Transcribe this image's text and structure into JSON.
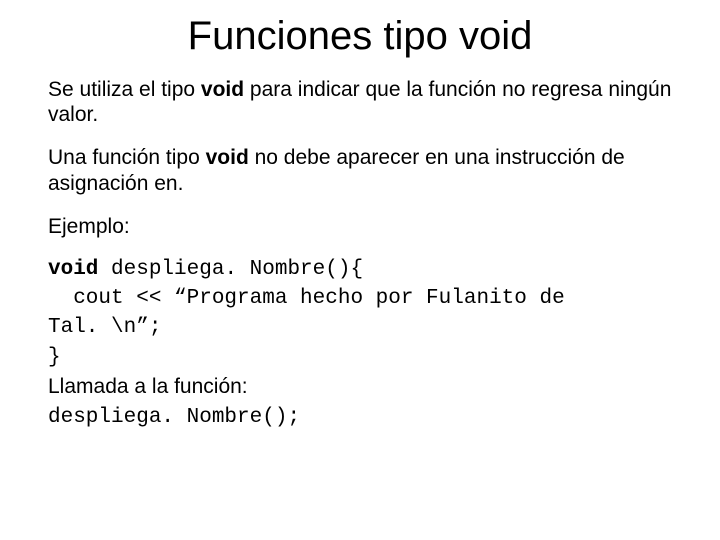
{
  "title": "Funciones tipo void",
  "para1": {
    "pre": "Se utiliza el tipo ",
    "bold": "void",
    "post": " para indicar que la función no regresa ningún valor."
  },
  "para2": {
    "pre": "Una función tipo ",
    "bold": "void",
    "post": " no debe aparecer en una instrucción de asignación en."
  },
  "exampleLabel": "Ejemplo:",
  "code": {
    "kw": "void",
    "sigRest": " despliega. Nombre(){",
    "line2": "cout << “Programa hecho por Fulanito de",
    "line3": "Tal. \\n”;",
    "line4": "}"
  },
  "callLabel": "Llamada a la función:",
  "callCode": "despliega. Nombre();"
}
